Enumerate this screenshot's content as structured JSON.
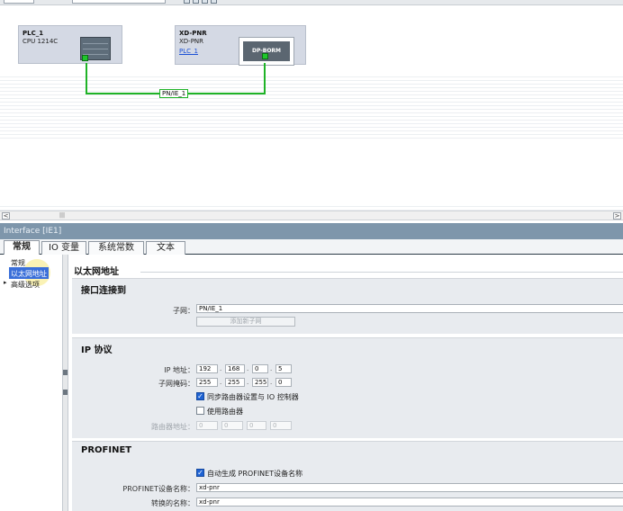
{
  "toolbar": {
    "icons": [
      "toolbar-icon-1",
      "toolbar-icon-2",
      "toolbar-icon-3",
      "toolbar-icon-4"
    ]
  },
  "network": {
    "devices": [
      {
        "name": "PLC_1",
        "type": "CPU 1214C",
        "link": ""
      },
      {
        "name": "XD-PNR",
        "type": "XD-PNR",
        "link": "PLC_1",
        "module_label": "DP-BORM"
      }
    ],
    "subnet_label": "PN/IE_1"
  },
  "scrollbar": {
    "left": "<",
    "right": ">",
    "grip": "|||"
  },
  "inspector": {
    "title": "Interface [IE1]",
    "tabs": [
      "常规",
      "IO 变量",
      "系统常数",
      "文本"
    ],
    "nav": {
      "items": [
        "常规",
        "以太网地址",
        "高级选项"
      ],
      "expand_marker": "▸"
    },
    "section_title": "以太网地址",
    "interface": {
      "title": "接口连接到",
      "subnet_label": "子网：",
      "subnet_value": "PN/IE_1",
      "add_subnet": "添加新子网"
    },
    "ip": {
      "title": "IP 协议",
      "ip_label": "IP 地址：",
      "ip_octets": [
        "192",
        "168",
        "0",
        "5"
      ],
      "mask_label": "子网掩码：",
      "mask_octets": [
        "255",
        "255",
        "255",
        "0"
      ],
      "sync_router": "同步路由器设置与 IO 控制器",
      "sync_router_checked": true,
      "use_router": "使用路由器",
      "use_router_checked": false,
      "router_label": "路由器地址：",
      "router_octets": [
        "0",
        "0",
        "0",
        "0"
      ]
    },
    "profinet": {
      "title": "PROFINET",
      "auto_name": "自动生成 PROFINET设备名称",
      "auto_name_checked": true,
      "device_name_label": "PROFINET设备名称：",
      "device_name_value": "xd-pnr",
      "converted_label": "转换的名称：",
      "converted_value": "xd-pnr"
    }
  },
  "colors": {
    "accent": "#3a6fd9",
    "network_line": "#1fb327",
    "inspector_title_bg": "#7e96ab"
  }
}
